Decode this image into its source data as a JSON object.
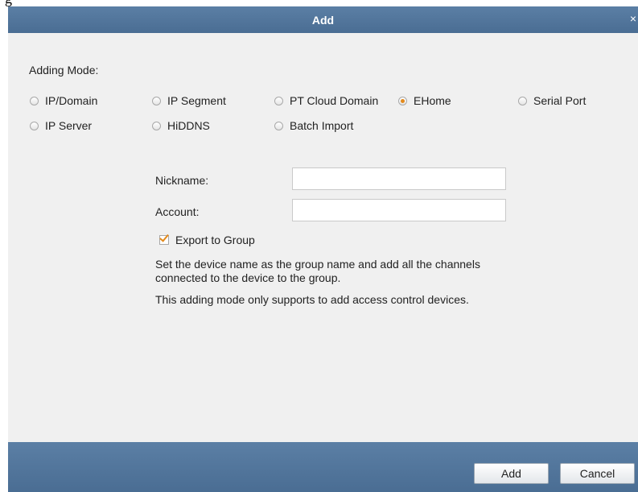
{
  "dialog": {
    "title": "Add",
    "close_label": "×"
  },
  "adding_mode": {
    "label": "Adding Mode:",
    "options": [
      {
        "label": "IP/Domain",
        "selected": false
      },
      {
        "label": "IP Segment",
        "selected": false
      },
      {
        "label": "PT Cloud Domain",
        "selected": false
      },
      {
        "label": "EHome",
        "selected": true
      },
      {
        "label": "Serial Port",
        "selected": false
      },
      {
        "label": "IP Server",
        "selected": false
      },
      {
        "label": "HiDDNS",
        "selected": false
      },
      {
        "label": "Batch Import",
        "selected": false
      }
    ]
  },
  "form": {
    "nickname_label": "Nickname:",
    "nickname_value": "",
    "account_label": "Account:",
    "account_value": "",
    "export_label": "Export to Group",
    "export_checked": true,
    "info_line1": "Set the device name as the group name and add all the channels connected to the device to the group.",
    "info_line2": "This adding mode only supports to add access control devices."
  },
  "buttons": {
    "add_label": "Add",
    "cancel_label": "Cancel"
  },
  "colors": {
    "accent": "#e38a1c",
    "titlebar": "#4f7399"
  }
}
